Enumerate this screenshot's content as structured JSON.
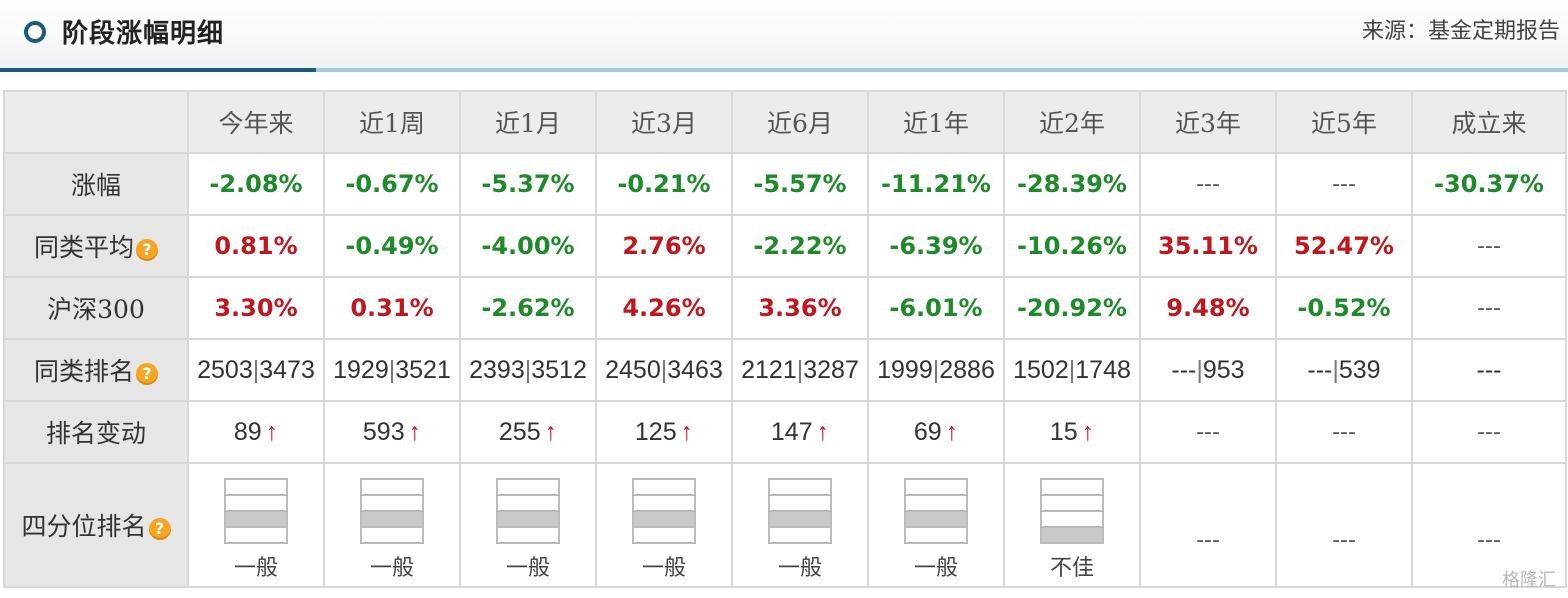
{
  "header": {
    "title": "阶段涨幅明细",
    "source": "来源：基金定期报告"
  },
  "columns": [
    "今年来",
    "近1周",
    "近1月",
    "近3月",
    "近6月",
    "近1年",
    "近2年",
    "近3年",
    "近5年",
    "成立来"
  ],
  "rows": {
    "gain": {
      "label": "涨幅",
      "values": [
        "-2.08%",
        "-0.67%",
        "-5.37%",
        "-0.21%",
        "-5.57%",
        "-11.21%",
        "-28.39%",
        "---",
        "---",
        "-30.37%"
      ],
      "colors": [
        "green",
        "green",
        "green",
        "green",
        "green",
        "green",
        "green",
        "dash",
        "dash",
        "green"
      ]
    },
    "peer_avg": {
      "label": "同类平均",
      "values": [
        "0.81%",
        "-0.49%",
        "-4.00%",
        "2.76%",
        "-2.22%",
        "-6.39%",
        "-10.26%",
        "35.11%",
        "52.47%",
        "---"
      ],
      "colors": [
        "red",
        "green",
        "green",
        "red",
        "green",
        "green",
        "green",
        "red",
        "red",
        "dash"
      ]
    },
    "csi300": {
      "label": "沪深300",
      "values": [
        "3.30%",
        "0.31%",
        "-2.62%",
        "4.26%",
        "3.36%",
        "-6.01%",
        "-20.92%",
        "9.48%",
        "-0.52%",
        "---"
      ],
      "colors": [
        "red",
        "red",
        "green",
        "red",
        "red",
        "green",
        "green",
        "red",
        "green",
        "dash"
      ]
    },
    "rank": {
      "label": "同类排名",
      "values": [
        {
          "rank": "2503",
          "total": "3473"
        },
        {
          "rank": "1929",
          "total": "3521"
        },
        {
          "rank": "2393",
          "total": "3512"
        },
        {
          "rank": "2450",
          "total": "3463"
        },
        {
          "rank": "2121",
          "total": "3287"
        },
        {
          "rank": "1999",
          "total": "2886"
        },
        {
          "rank": "1502",
          "total": "1748"
        },
        {
          "rank": "---",
          "total": "953"
        },
        {
          "rank": "---",
          "total": "539"
        },
        {
          "rank": "---",
          "total": ""
        }
      ]
    },
    "rank_change": {
      "label": "排名变动",
      "values": [
        "89",
        "593",
        "255",
        "125",
        "147",
        "69",
        "15",
        "---",
        "---",
        "---"
      ],
      "arrow": "↑"
    },
    "quartile": {
      "label": "四分位排名",
      "values": [
        {
          "label": "一般",
          "level": 2
        },
        {
          "label": "一般",
          "level": 2
        },
        {
          "label": "一般",
          "level": 2
        },
        {
          "label": "一般",
          "level": 2
        },
        {
          "label": "一般",
          "level": 2
        },
        {
          "label": "一般",
          "level": 2
        },
        {
          "label": "不佳",
          "level": 1
        },
        {
          "label": "---",
          "level": 0
        },
        {
          "label": "---",
          "level": 0
        },
        {
          "label": "---",
          "level": 0
        }
      ]
    }
  },
  "help_icon": "?",
  "watermark": "格隆汇",
  "colors": {
    "up": "#c0161e",
    "down": "#1e8a2a",
    "brand": "#1c5a7e"
  }
}
